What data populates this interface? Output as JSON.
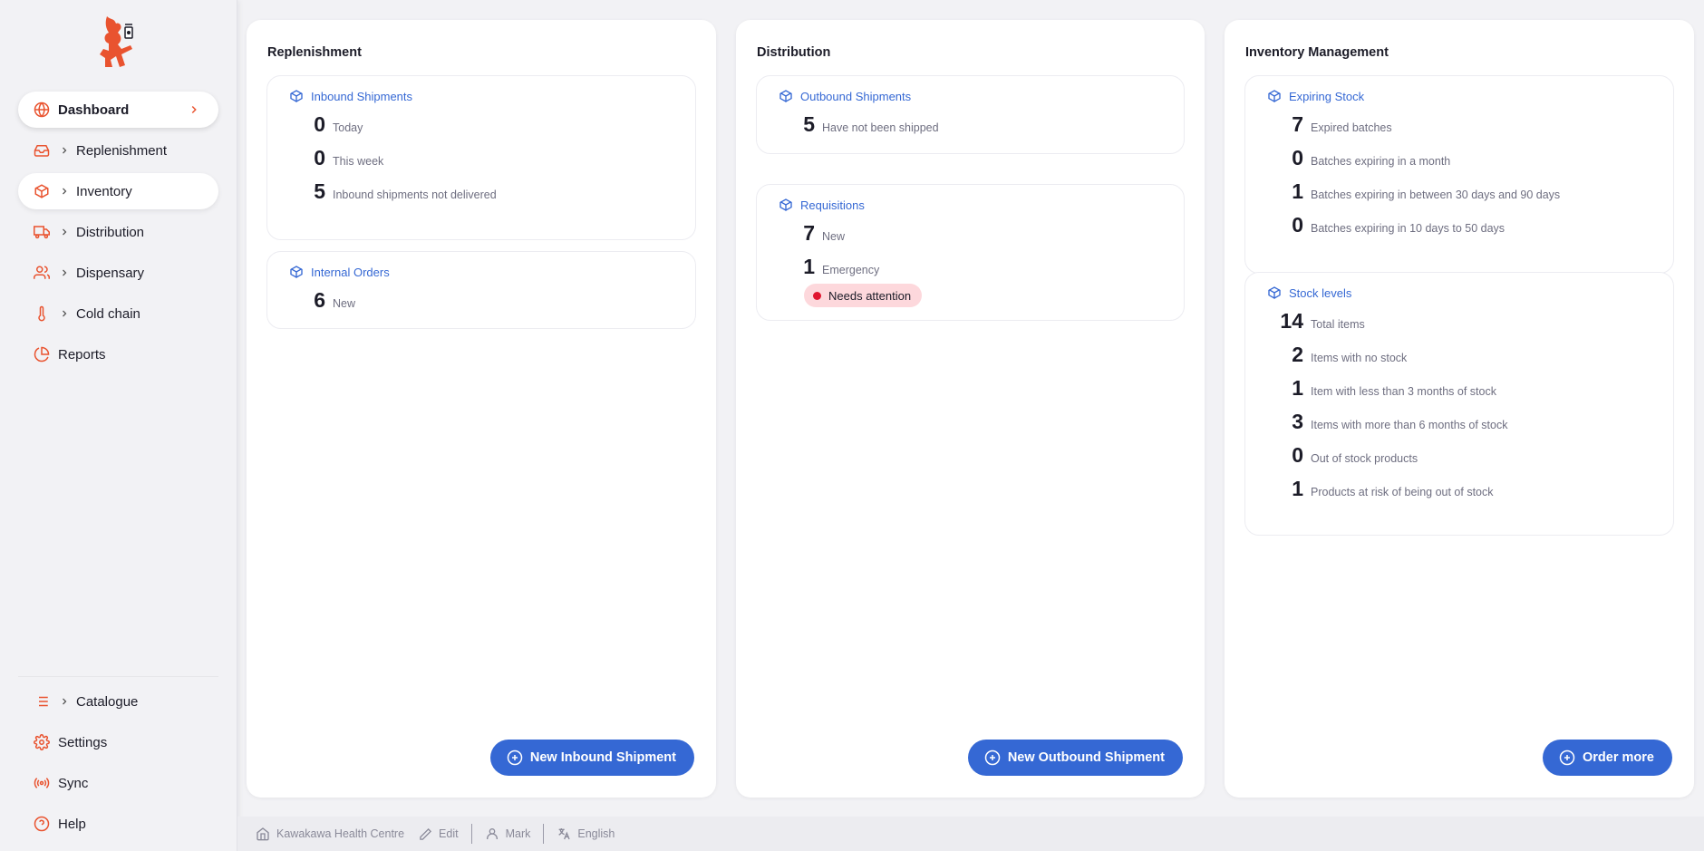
{
  "sidebar": {
    "nav": [
      {
        "label": "Dashboard",
        "icon": "globe-icon",
        "active": true
      },
      {
        "label": "Replenishment",
        "icon": "inbox-icon",
        "expandable": true
      },
      {
        "label": "Inventory",
        "icon": "box-icon",
        "expandable": true,
        "hover": true
      },
      {
        "label": "Distribution",
        "icon": "truck-icon",
        "expandable": true
      },
      {
        "label": "Dispensary",
        "icon": "users-icon",
        "expandable": true
      },
      {
        "label": "Cold chain",
        "icon": "thermometer-icon",
        "expandable": true
      },
      {
        "label": "Reports",
        "icon": "pie-chart-icon"
      }
    ],
    "bottom": [
      {
        "label": "Catalogue",
        "icon": "list-icon",
        "expandable": true
      },
      {
        "label": "Settings",
        "icon": "gear-icon"
      },
      {
        "label": "Sync",
        "icon": "radio-icon"
      },
      {
        "label": "Help",
        "icon": "help-circle-icon"
      }
    ]
  },
  "cards": {
    "replenishment": {
      "title": "Replenishment",
      "inbound": {
        "heading": "Inbound Shipments",
        "stats": [
          {
            "value": "0",
            "label": "Today"
          },
          {
            "value": "0",
            "label": "This week"
          },
          {
            "value": "5",
            "label": "Inbound shipments not delivered"
          }
        ]
      },
      "internal": {
        "heading": "Internal Orders",
        "stats": [
          {
            "value": "6",
            "label": "New"
          }
        ]
      },
      "button": "New Inbound Shipment"
    },
    "distribution": {
      "title": "Distribution",
      "outbound": {
        "heading": "Outbound Shipments",
        "stats": [
          {
            "value": "5",
            "label": "Have not been shipped"
          }
        ]
      },
      "requisitions": {
        "heading": "Requisitions",
        "stats": [
          {
            "value": "7",
            "label": "New"
          },
          {
            "value": "1",
            "label": "Emergency"
          }
        ],
        "badge": "Needs attention"
      },
      "button": "New Outbound Shipment"
    },
    "inventory": {
      "title": "Inventory Management",
      "expiring": {
        "heading": "Expiring Stock",
        "stats": [
          {
            "value": "7",
            "label": "Expired batches"
          },
          {
            "value": "0",
            "label": "Batches expiring in a month"
          },
          {
            "value": "1",
            "label": "Batches expiring in between 30 days and 90 days"
          },
          {
            "value": "0",
            "label": "Batches expiring in 10 days to 50 days"
          }
        ]
      },
      "stock": {
        "heading": "Stock levels",
        "stats": [
          {
            "value": "14",
            "label": "Total items"
          },
          {
            "value": "2",
            "label": "Items with no stock"
          },
          {
            "value": "1",
            "label": "Item with less than 3 months of stock"
          },
          {
            "value": "3",
            "label": "Items with more than 6 months of stock"
          },
          {
            "value": "0",
            "label": "Out of stock products"
          },
          {
            "value": "1",
            "label": "Products at risk of being out of stock"
          }
        ]
      },
      "button": "Order more"
    }
  },
  "footer": {
    "store": "Kawakawa Health Centre",
    "edit": "Edit",
    "user": "Mark",
    "language": "English"
  },
  "colors": {
    "brand": "#e9532f",
    "accent": "#3568d4",
    "badge_bg": "#fdd8dc",
    "badge_dot": "#e0152f"
  }
}
